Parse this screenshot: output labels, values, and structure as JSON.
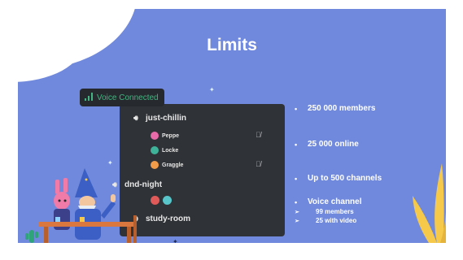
{
  "slide": {
    "title": "Limits"
  },
  "voice_connected": {
    "label": "Voice Connected",
    "color": "#43b581"
  },
  "channels": [
    {
      "name": "just-chillin",
      "users": [
        {
          "name": "Peppe",
          "avatar_color": "#e86aa8",
          "muted": true
        },
        {
          "name": "Locke",
          "avatar_color": "#3fb39a",
          "muted": false
        },
        {
          "name": "Graggle",
          "avatar_color": "#f29c4a",
          "muted": true
        }
      ]
    },
    {
      "name": "dnd-night",
      "users": [
        {
          "name": "",
          "avatar_color": "#e05a5a",
          "muted": false
        },
        {
          "name": "",
          "avatar_color": "#57c5c9",
          "muted": false
        }
      ]
    },
    {
      "name": "study-room",
      "users": []
    }
  ],
  "limits": {
    "items": [
      "250 000 members",
      "25 000 online",
      "Up to 500 channels",
      "Voice channel"
    ],
    "sub_items": [
      "99 members",
      "25 with video"
    ],
    "bullet": "•",
    "sub_bullet": "➢"
  },
  "icons": {
    "speaker": "speaker-icon",
    "mute": "mic-off-icon",
    "signal": "signal-bars-icon"
  },
  "colors": {
    "slide_bg": "#7089dc",
    "panel_bg": "#2f3237",
    "accent_yellow": "#f6c94a"
  }
}
